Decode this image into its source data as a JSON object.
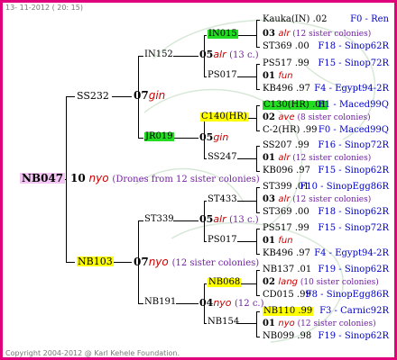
{
  "header": {
    "date": "13- 11-2012 ( 20: 15)"
  },
  "footer": {
    "copyright": "Copyright 2004-2012 @ Karl Kehele Foundation."
  },
  "root": {
    "id": "NB047",
    "year": "10",
    "line": "nyo",
    "note": "(Drones from 12 sister colonies)"
  },
  "sire": {
    "id": "SS232",
    "year": "07",
    "line": "gin"
  },
  "dam": {
    "id": "NB103",
    "year": "07",
    "line": "nyo",
    "note": "(12 sister colonies)"
  },
  "gen2": [
    {
      "id": "IN152",
      "year": "05",
      "line": "alr",
      "note": "(13 c.)"
    },
    {
      "id": "JR019",
      "year": "05",
      "line": "gin",
      "note": ""
    },
    {
      "id": "ST339",
      "year": "05",
      "line": "alr",
      "note": "(13 c.)"
    },
    {
      "id": "NB191",
      "year": "04",
      "line": "nyo",
      "note": "(12 c.)"
    }
  ],
  "gen3": [
    "IN015",
    "PS017",
    "C140(HR)",
    "SS247",
    "ST433",
    "PS017",
    "NB068",
    "NB154"
  ],
  "gen4": [
    {
      "kind": "id",
      "text": "Kauka(IN) .02",
      "right": "F0 - Ren",
      "hl": ""
    },
    {
      "kind": "gen",
      "year": "03",
      "line": "alr",
      "note": "(12 sister colonies)"
    },
    {
      "kind": "id",
      "text": "ST369 .00",
      "right": "F18 - Sinop62R",
      "hl": ""
    },
    {
      "kind": "id",
      "text": "PS517 .99",
      "right": "F15 - Sinop72R",
      "hl": ""
    },
    {
      "kind": "gen",
      "year": "01",
      "line": "fun",
      "note": ""
    },
    {
      "kind": "id",
      "text": "KB496 .97",
      "right": "F4 - Egypt94-2R",
      "hl": ""
    },
    {
      "kind": "id",
      "text": "C130(HR) .01",
      "right": "F1 - Maced99Q",
      "hl": "green"
    },
    {
      "kind": "gen",
      "year": "02",
      "line": "ave",
      "note": "(8 sister colonies)"
    },
    {
      "kind": "id",
      "text": "C-2(HR) .99",
      "right": "F0 - Maced99Q",
      "hl": ""
    },
    {
      "kind": "id",
      "text": "SS207 .99",
      "right": "F16 - Sinop72R",
      "hl": ""
    },
    {
      "kind": "gen",
      "year": "01",
      "line": "alr",
      "note": "(12 sister colonies)"
    },
    {
      "kind": "id",
      "text": "KB096 .97",
      "right": "F15 - Sinop62R",
      "hl": ""
    },
    {
      "kind": "id",
      "text": "ST399 .01",
      "right": "F10 - SinopEgg86R",
      "hl": ""
    },
    {
      "kind": "gen",
      "year": "03",
      "line": "alr",
      "note": "(12 sister colonies)"
    },
    {
      "kind": "id",
      "text": "ST369 .00",
      "right": "F18 - Sinop62R",
      "hl": ""
    },
    {
      "kind": "id",
      "text": "PS517 .99",
      "right": "F15 - Sinop72R",
      "hl": ""
    },
    {
      "kind": "gen",
      "year": "01",
      "line": "fun",
      "note": ""
    },
    {
      "kind": "id",
      "text": "KB496 .97",
      "right": "F4 - Egypt94-2R",
      "hl": ""
    },
    {
      "kind": "id",
      "text": "NB137 .01",
      "right": "F19 - Sinop62R",
      "hl": ""
    },
    {
      "kind": "gen",
      "year": "02",
      "line": "lang",
      "note": "(10 sister colonies)"
    },
    {
      "kind": "id",
      "text": "CD015 .99",
      "right": "F8 - SinopEgg86R",
      "hl": ""
    },
    {
      "kind": "id",
      "text": "NB110 .99",
      "right": "F3 - Carnic92R",
      "hl": "yellow"
    },
    {
      "kind": "gen",
      "year": "01",
      "line": "nyo",
      "note": "(12 sister colonies)"
    },
    {
      "kind": "id",
      "text": "NB099 .98",
      "right": "F19 - Sinop62R",
      "hl": ""
    }
  ]
}
